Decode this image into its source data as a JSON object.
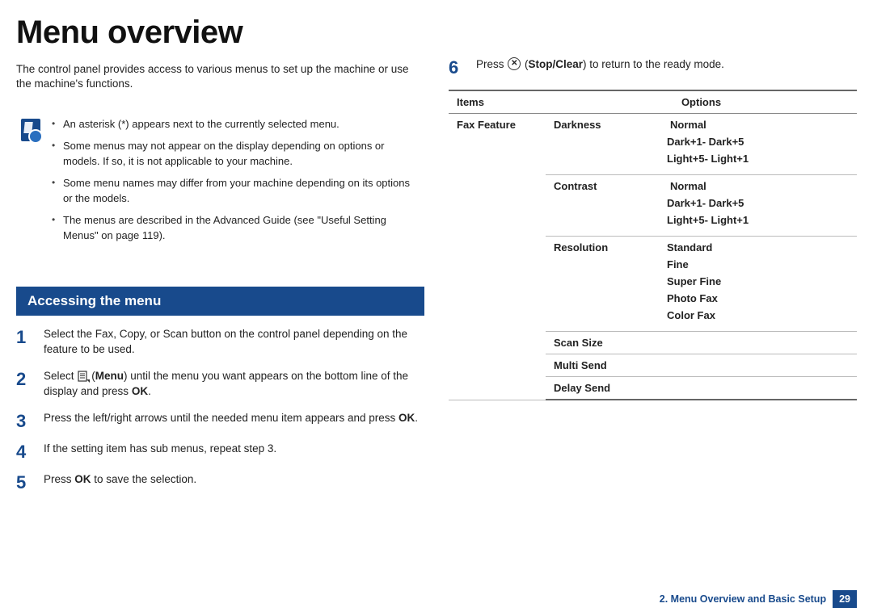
{
  "title": "Menu overview",
  "intro": "The control panel provides access to various menus to set up the machine or use the machine's functions.",
  "notes": [
    "An asterisk (*) appears next to the currently selected menu.",
    "Some menus may not appear on the display depending on options or models. If so, it is not applicable to your machine.",
    "Some menu names may differ from your machine depending on its options or the models.",
    "The menus are described in the Advanced Guide (see \"Useful Setting Menus\" on page 119)."
  ],
  "section_heading": "Accessing the menu",
  "steps": {
    "s1": {
      "num": "1",
      "text": "Select the Fax, Copy, or Scan button on the control panel depending on the feature to be used."
    },
    "s2": {
      "num": "2",
      "pre": "Select ",
      "menu_label": "Menu",
      "post": ") until the menu you want appears on the bottom line of the display and press ",
      "ok": "OK",
      "end": "."
    },
    "s3": {
      "num": "3",
      "pre": "Press the left/right arrows until the needed menu item appears and press ",
      "ok": "OK",
      "end": "."
    },
    "s4": {
      "num": "4",
      "text": "If the setting item has sub menus, repeat step 3."
    },
    "s5": {
      "num": "5",
      "pre": "Press ",
      "ok": "OK",
      "post": " to save the selection."
    },
    "s6": {
      "num": "6",
      "pre": "Press ",
      "stop_glyph": "✕",
      "stop_label": "Stop/Clear",
      "post": ") to return to the ready mode."
    }
  },
  "table": {
    "head_items": "Items",
    "head_options": "Options",
    "item_name": "Fax Feature",
    "darkness": {
      "label": "Darkness",
      "v1": "Normal",
      "v2": "Dark+1- Dark+5",
      "v3": "Light+5- Light+1"
    },
    "contrast": {
      "label": "Contrast",
      "v1": "Normal",
      "v2": "Dark+1- Dark+5",
      "v3": "Light+5- Light+1"
    },
    "resolution": {
      "label": "Resolution",
      "v1": "Standard",
      "v2": "Fine",
      "v3": "Super Fine",
      "v4": "Photo Fax",
      "v5": "Color Fax"
    },
    "scan_size": "Scan Size",
    "multi_send": "Multi Send",
    "delay_send": "Delay Send"
  },
  "footer": {
    "chapter": "2.  Menu Overview and Basic Setup",
    "page": "29"
  }
}
